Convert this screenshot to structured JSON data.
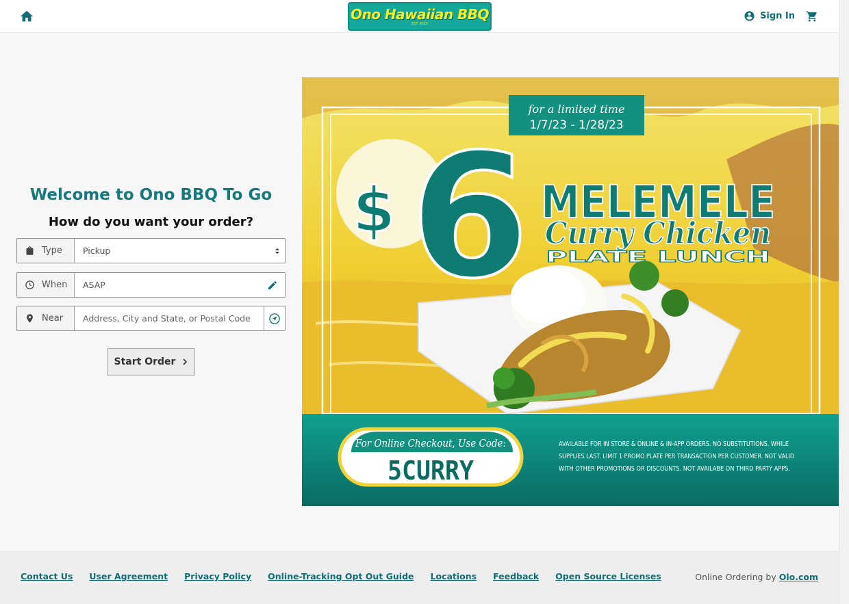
{
  "header": {
    "logo_text": "Ono Hawaiian BBQ",
    "logo_est": "EST 2003",
    "signin_label": "Sign In"
  },
  "order": {
    "welcome": "Welcome to Ono BBQ To Go",
    "question": "How do you want your order?",
    "type_label": "Type",
    "type_value": "Pickup",
    "when_label": "When",
    "when_value": "ASAP",
    "near_label": "Near",
    "near_placeholder": "Address, City and State, or Postal Code",
    "start_label": "Start Order"
  },
  "promo": {
    "limited": "for a limited time",
    "dates": "1/7/23 - 1/28/23",
    "price_symbol": "$",
    "price": "6",
    "title1": "MELEMELE",
    "title2": "Curry Chicken",
    "title3": "PLATE LUNCH",
    "code_label": "For Online Checkout, Use Code:",
    "code": "5CURRY",
    "fine_print_1": "AVAILABLE FOR IN STORE & ONLINE & IN-APP ORDERS. NO SUBSTITUTIONS. WHILE",
    "fine_print_2": "SUPPLIES LAST. LIMIT 1 PROMO PLATE PER TRANSACTION PER CUSTOMER. NOT VALID",
    "fine_print_3": "WITH OTHER PROMOTIONS OR DISCOUNTS. NOT AVAILABE ON THIRD PARTY APPS.",
    "colors": {
      "teal": "#0f8a7f",
      "dark_teal": "#0b6b63",
      "yellow": "#f3d23a"
    }
  },
  "footer": {
    "links": [
      "Contact Us",
      "User Agreement",
      "Privacy Policy",
      "Online-Tracking Opt Out Guide",
      "Locations",
      "Feedback",
      "Open Source Licenses"
    ],
    "powered_prefix": "Online Ordering by",
    "powered_link": "Olo.com"
  },
  "colors": {
    "accent": "#126d74",
    "logo_bg": "#13a89a",
    "logo_text": "#f5ec24"
  }
}
